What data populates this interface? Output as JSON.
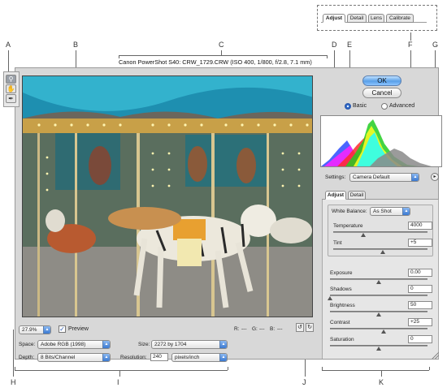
{
  "callouts": {
    "A": "A",
    "B": "B",
    "C": "C",
    "D": "D",
    "E": "E",
    "F": "F",
    "G": "G",
    "H": "H",
    "I": "I",
    "J": "J",
    "K": "K"
  },
  "header": {
    "title": "Canon PowerShot S40:  CRW_1729.CRW  (ISO 400, 1/800, f/2.8, 7.1 mm)"
  },
  "top_tabs": {
    "adjust": "Adjust",
    "detail": "Detail",
    "lens": "Lens",
    "calibrate": "Calibrate"
  },
  "tools": {
    "zoom_icon": "zoom-tool",
    "hand_icon": "hand-tool",
    "eyedropper_icon": "white-balance-tool"
  },
  "buttons": {
    "ok": "OK",
    "cancel": "Cancel"
  },
  "mode": {
    "basic": "Basic",
    "advanced": "Advanced",
    "selected": "Basic"
  },
  "histogram": {
    "colors": [
      "#ff2a2a",
      "#22cc22",
      "#2a4aff",
      "#ffff22",
      "#ff22ff",
      "#22ffff",
      "#ffffff"
    ]
  },
  "settings": {
    "label": "Settings:",
    "value": "Camera Default"
  },
  "panel_tabs": {
    "adjust": "Adjust",
    "detail": "Detail"
  },
  "white_balance": {
    "label": "White Balance:",
    "value": "As Shot"
  },
  "adjustments": {
    "temperature": {
      "label": "Temperature",
      "value": "4000",
      "level": 0.32
    },
    "tint": {
      "label": "Tint",
      "value": "+5",
      "level": 0.53
    },
    "exposure": {
      "label": "Exposure",
      "value": "0.00",
      "level": 0.5
    },
    "shadows": {
      "label": "Shadows",
      "value": "0",
      "level": 0.0
    },
    "brightness": {
      "label": "Brightness",
      "value": "50",
      "level": 0.5
    },
    "contrast": {
      "label": "Contrast",
      "value": "+25",
      "level": 0.55
    },
    "saturation": {
      "label": "Saturation",
      "value": "0",
      "level": 0.5
    }
  },
  "bottom_bar": {
    "zoom": "27.9%",
    "preview_label": "Preview",
    "preview_checked": true,
    "r_label": "R:",
    "g_label": "G:",
    "b_label": "B:",
    "r_value": "---",
    "g_value": "---",
    "b_value": "---"
  },
  "workflow": {
    "space_label": "Space:",
    "space_value": "Adobe RGB (1998)",
    "size_label": "Size:",
    "size_value": "2272 by 1704",
    "depth_label": "Depth:",
    "depth_value": "8 Bits/Channel",
    "resolution_label": "Resolution:",
    "resolution_value": "240",
    "resolution_unit": "pixels/inch"
  },
  "rotate": {
    "left_icon": "rotate-left-icon",
    "right_icon": "rotate-right-icon"
  }
}
